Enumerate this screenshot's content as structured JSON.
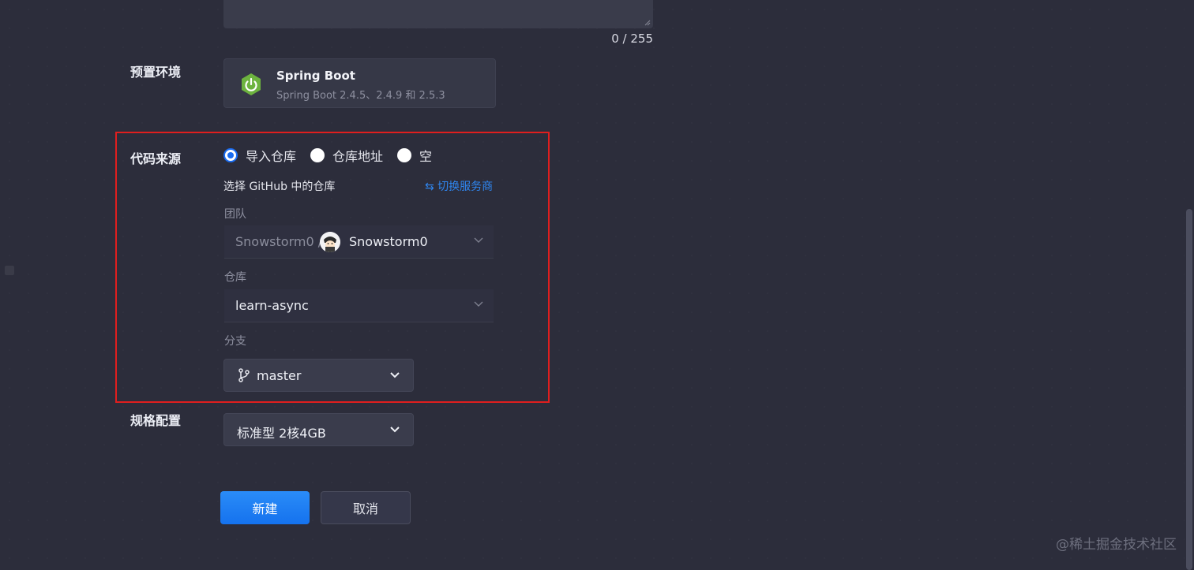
{
  "description": {
    "counter": "0 / 255"
  },
  "preset_env": {
    "label": "预置环境",
    "title": "Spring Boot",
    "subtitle": "Spring Boot 2.4.5、2.4.9 和 2.5.3",
    "icon": "spring-boot-power-icon",
    "icon_color": "#6db33f"
  },
  "code_source": {
    "label": "代码来源",
    "options": [
      {
        "label": "导入仓库",
        "checked": true
      },
      {
        "label": "仓库地址",
        "checked": false
      },
      {
        "label": "空",
        "checked": false
      }
    ],
    "hint": "选择 GitHub 中的仓库",
    "switch_provider": "⇆ 切换服务商",
    "team": {
      "label": "团队",
      "owner": "Snowstorm0 /",
      "name": "Snowstorm0"
    },
    "repo": {
      "label": "仓库",
      "value": "learn-async"
    },
    "branch": {
      "label": "分支",
      "value": "master"
    }
  },
  "spec": {
    "label": "规格配置",
    "value": "标准型 2核4GB"
  },
  "actions": {
    "create": "新建",
    "cancel": "取消"
  },
  "watermark": "@稀土掘金技术社区",
  "colors": {
    "background": "#2c2d3b",
    "accent_blue": "#1a6cf0",
    "highlight_red": "#e01e1e"
  }
}
